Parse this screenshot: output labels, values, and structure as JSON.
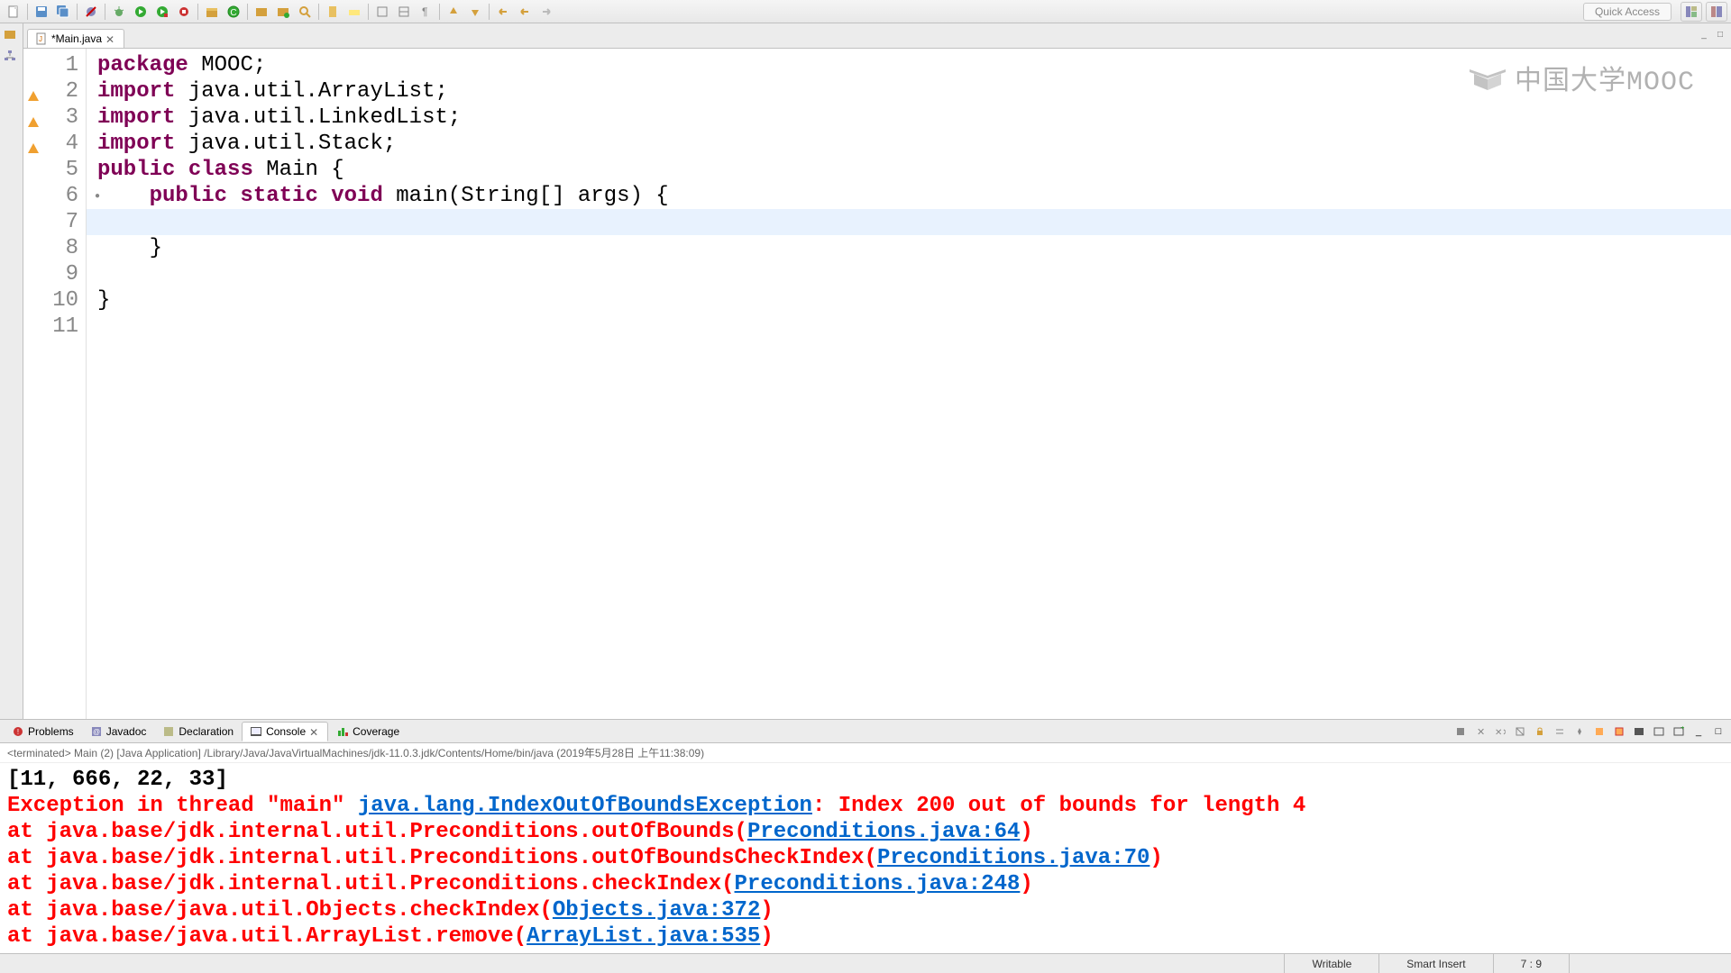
{
  "quickAccess": "Quick Access",
  "editor": {
    "tab": {
      "label": "*Main.java"
    },
    "gutter": [
      "1",
      "2",
      "3",
      "4",
      "5",
      "6",
      "7",
      "8",
      "9",
      "10",
      "11"
    ],
    "currentLine": 7,
    "code": {
      "l1": {
        "kw": "package",
        "rest": " MOOC;"
      },
      "l2": {
        "kw": "import",
        "rest": " java.util.ArrayList;"
      },
      "l3": {
        "kw": "import",
        "rest": " java.util.LinkedList;"
      },
      "l4": {
        "kw": "import",
        "rest": " java.util.Stack;"
      },
      "l5": {
        "kw1": "public",
        "kw2": "class",
        "name": " Main {"
      },
      "l6": {
        "indent": "    ",
        "kw": "public static void",
        "name": " main(String[] args) {"
      },
      "l7": "",
      "l8": "    }",
      "l9": "",
      "l10": "}",
      "l11": ""
    }
  },
  "watermark": "中国大学MOOC",
  "bottomTabs": {
    "problems": "Problems",
    "javadoc": "Javadoc",
    "declaration": "Declaration",
    "console": "Console",
    "coverage": "Coverage"
  },
  "console": {
    "header": "<terminated> Main (2) [Java Application] /Library/Java/JavaVirtualMachines/jdk-11.0.3.jdk/Contents/Home/bin/java (2019年5月28日 上午11:38:09)",
    "out1": "[11, 666, 22, 33]",
    "err": {
      "pre": "Exception in thread \"main\" ",
      "exClass": "java.lang.IndexOutOfBoundsException",
      "msg": ": Index 200 out of bounds for length 4",
      "t1a": "        at java.base/jdk.internal.util.Preconditions.outOfBounds(",
      "t1link": "Preconditions.java:64",
      "t1b": ")",
      "t2a": "        at java.base/jdk.internal.util.Preconditions.outOfBoundsCheckIndex(",
      "t2link": "Preconditions.java:70",
      "t2b": ")",
      "t3a": "        at java.base/jdk.internal.util.Preconditions.checkIndex(",
      "t3link": "Preconditions.java:248",
      "t3b": ")",
      "t4a": "        at java.base/java.util.Objects.checkIndex(",
      "t4link": "Objects.java:372",
      "t4b": ")",
      "t5a": "        at java.base/java.util.ArrayList.remove(",
      "t5link": "ArrayList.java:535",
      "t5b": ")"
    }
  },
  "status": {
    "writable": "Writable",
    "insert": "Smart Insert",
    "pos": "7 : 9"
  }
}
